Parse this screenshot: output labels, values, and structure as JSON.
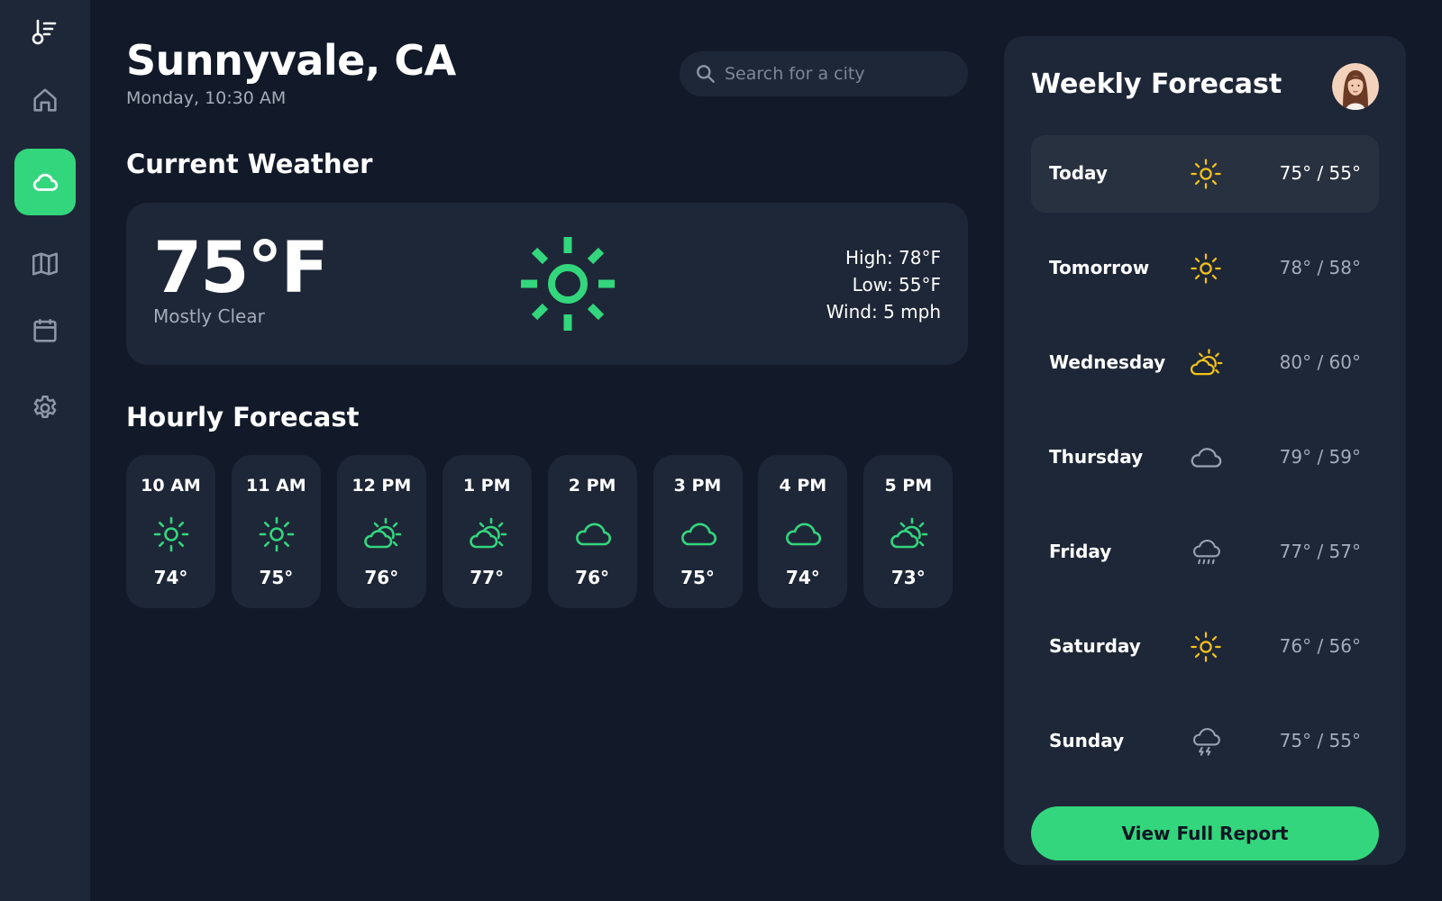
{
  "colors": {
    "accent": "#33d67d",
    "sun": "#f4c21a",
    "muted_icon": "#9aa3b2",
    "background": "#121a29",
    "card": "#1e2737"
  },
  "sidebar": {
    "items": [
      {
        "name": "home",
        "icon": "home-icon"
      },
      {
        "name": "weather",
        "icon": "cloud-icon",
        "active": true
      },
      {
        "name": "map",
        "icon": "map-icon"
      },
      {
        "name": "calendar",
        "icon": "calendar-icon"
      },
      {
        "name": "settings",
        "icon": "gear-icon"
      }
    ]
  },
  "header": {
    "city": "Sunnyvale, CA",
    "date": "Monday, 10:30 AM"
  },
  "search": {
    "placeholder": "Search for a city",
    "value": ""
  },
  "current": {
    "section_title": "Current Weather",
    "temperature": "75°F",
    "condition": "Mostly Clear",
    "high": "High: 78°F",
    "low": "Low: 55°F",
    "wind": "Wind: 5 mph",
    "icon": "sun-icon"
  },
  "hourly": {
    "section_title": "Hourly Forecast",
    "items": [
      {
        "time": "10 AM",
        "icon": "sun",
        "temp": "74°"
      },
      {
        "time": "11 AM",
        "icon": "sun",
        "temp": "75°"
      },
      {
        "time": "12 PM",
        "icon": "partly-cloudy",
        "temp": "76°"
      },
      {
        "time": "1 PM",
        "icon": "partly-cloudy",
        "temp": "77°"
      },
      {
        "time": "2 PM",
        "icon": "cloud",
        "temp": "76°"
      },
      {
        "time": "3 PM",
        "icon": "cloud",
        "temp": "75°"
      },
      {
        "time": "4 PM",
        "icon": "cloud",
        "temp": "74°"
      },
      {
        "time": "5 PM",
        "icon": "partly-cloudy",
        "temp": "73°"
      }
    ]
  },
  "weekly": {
    "title": "Weekly Forecast",
    "days": [
      {
        "day": "Today",
        "icon": "sun",
        "temps": "75° / 55°"
      },
      {
        "day": "Tomorrow",
        "icon": "sun",
        "temps": "78° / 58°"
      },
      {
        "day": "Wednesday",
        "icon": "partly-cloudy",
        "temps": "80° / 60°"
      },
      {
        "day": "Thursday",
        "icon": "cloud",
        "temps": "79° / 59°"
      },
      {
        "day": "Friday",
        "icon": "rain",
        "temps": "77° / 57°"
      },
      {
        "day": "Saturday",
        "icon": "sun",
        "temps": "76° / 56°"
      },
      {
        "day": "Sunday",
        "icon": "storm",
        "temps": "75° / 55°"
      }
    ],
    "button_label": "View Full Report"
  }
}
